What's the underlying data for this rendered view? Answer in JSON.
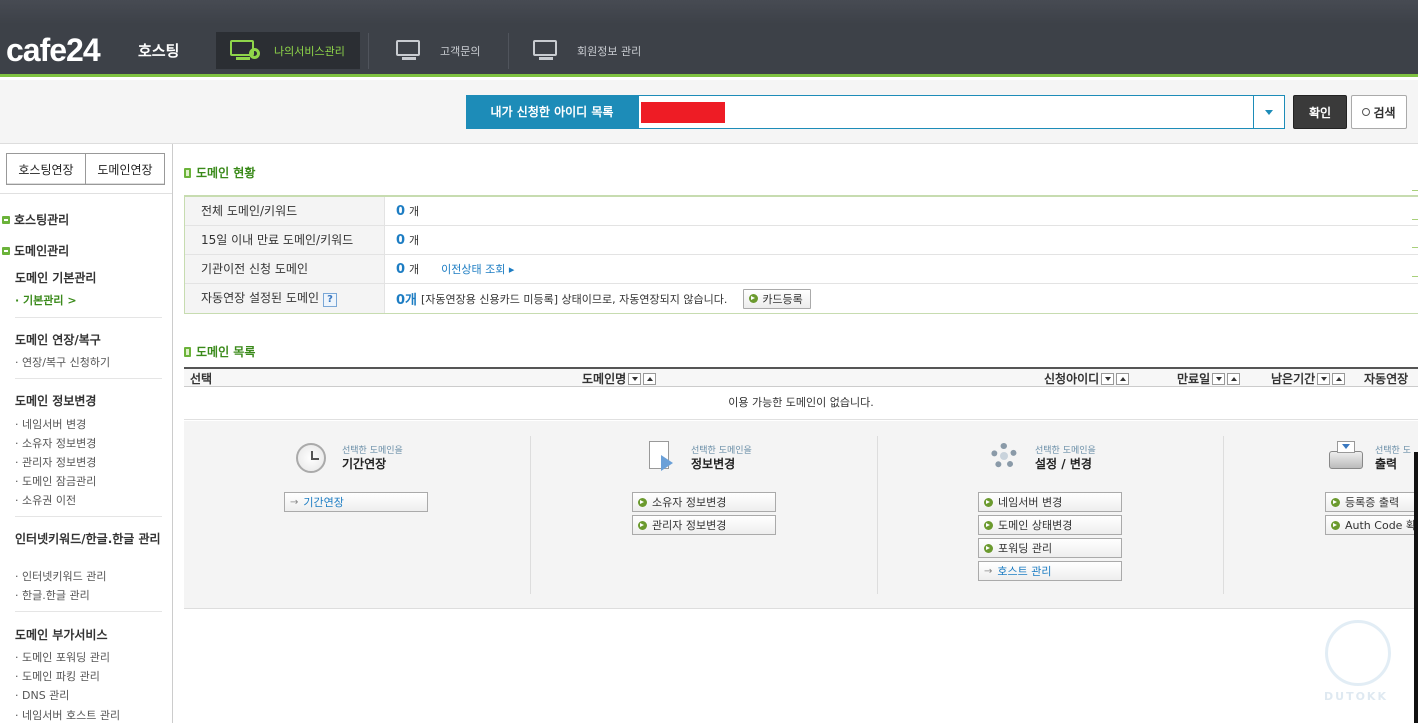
{
  "header": {
    "logo": "cafe24",
    "logo_sub": "호스팅",
    "nav": [
      {
        "label": "나의서비스관리",
        "active": true
      },
      {
        "label": "고객문의",
        "active": false
      },
      {
        "label": "회원정보 관리",
        "active": false
      }
    ]
  },
  "search": {
    "id_label": "내가 신청한 아이디 목록",
    "confirm_label": "확인",
    "search_label": "검색"
  },
  "sidebar": {
    "tabs": [
      "호스팅연장",
      "도메인연장"
    ],
    "categories": [
      "호스팅관리",
      "도메인관리"
    ],
    "groups": [
      {
        "title": "도메인 기본관리",
        "items": [
          "· 기본관리 >"
        ]
      },
      {
        "title": "도메인 연장/복구",
        "items": [
          "· 연장/복구 신청하기"
        ]
      },
      {
        "title": "도메인 정보변경",
        "items": [
          "· 네임서버 변경",
          "· 소유자 정보변경",
          "· 관리자 정보변경",
          "· 도메인 잠금관리",
          "· 소유권 이전"
        ]
      },
      {
        "title": "인터넷키워드/한글.한글 관리",
        "items": [
          "· 인터넷키워드 관리",
          "· 한글.한글 관리"
        ]
      },
      {
        "title": "도메인 부가서비스",
        "items": [
          "· 도메인 포워딩 관리",
          "· 도메인 파킹 관리",
          "· DNS 관리",
          "· 네임서버 호스트 관리"
        ]
      }
    ]
  },
  "status": {
    "title": "도메인 현황",
    "rows": [
      {
        "label": "전체 도메인/키워드",
        "count": "0",
        "unit": "개"
      },
      {
        "label": "15일 이내 만료 도메인/키워드",
        "count": "0",
        "unit": "개"
      },
      {
        "label": "기관이전 신청 도메인",
        "count": "0",
        "unit": "개",
        "link": "이전상태 조회 ▸"
      },
      {
        "label": "자동연장 설정된 도메인",
        "help": "?",
        "count": "0개",
        "note": "[자동연장용 신용카드 미등록] 상태이므로, 자동연장되지 않습니다.",
        "button": "카드등록"
      }
    ]
  },
  "list": {
    "title": "도메인 목록",
    "columns": [
      "선택",
      "도메인명",
      "신청아이디",
      "만료일",
      "남은기간",
      "자동연장"
    ],
    "empty_message": "이용 가능한 도메인이 없습니다."
  },
  "actions": [
    {
      "small": "선택한 도메인을",
      "big": "기간연장",
      "buttons": [
        {
          "label": "기간연장",
          "plain": true
        }
      ]
    },
    {
      "small": "선택한 도메인을",
      "big": "정보변경",
      "buttons": [
        {
          "label": "소유자 정보변경"
        },
        {
          "label": "관리자 정보변경"
        }
      ]
    },
    {
      "small": "선택한 도메인을",
      "big": "설정 / 변경",
      "buttons": [
        {
          "label": "네임서버 변경"
        },
        {
          "label": "도메인 상태변경"
        },
        {
          "label": "포워딩 관리"
        },
        {
          "label": "호스트 관리",
          "plain": true
        }
      ]
    },
    {
      "small": "선택한 도",
      "big": "출력",
      "buttons": [
        {
          "label": "등록증 출력"
        },
        {
          "label": "Auth Code 확"
        }
      ]
    }
  ],
  "watermark": "DUTOKK",
  "colors": {
    "accent_green": "#7fc241",
    "accent_blue": "#1d8cb8",
    "redaction": "#ee1c25"
  }
}
